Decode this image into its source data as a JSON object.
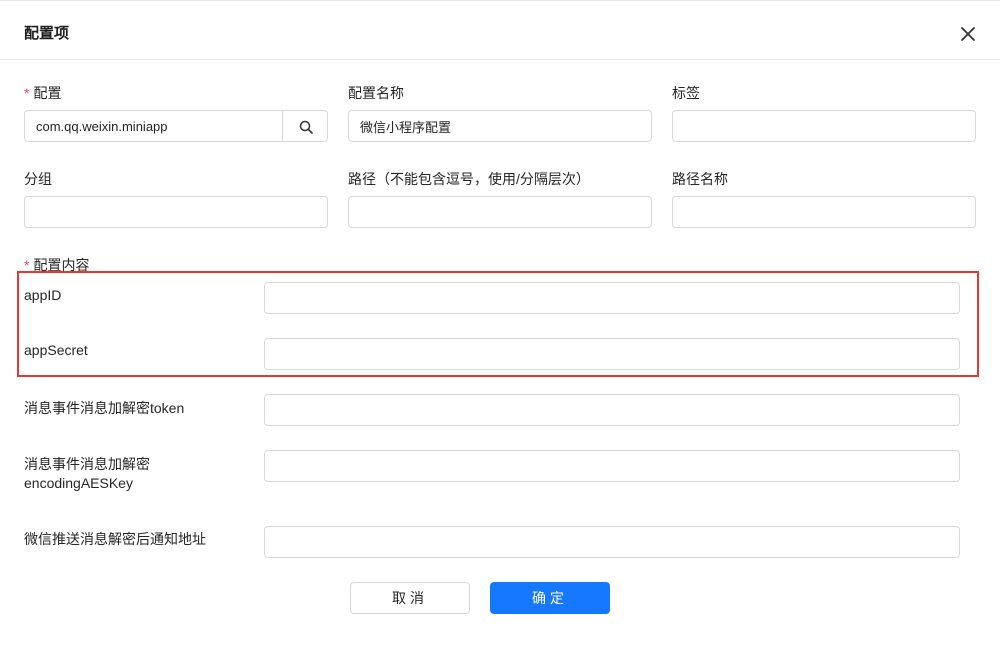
{
  "dialog": {
    "title": "配置项"
  },
  "form": {
    "config": {
      "label": "配置",
      "value": "com.qq.weixin.miniapp"
    },
    "config_name": {
      "label": "配置名称",
      "value": "微信小程序配置"
    },
    "tags": {
      "label": "标签",
      "value": ""
    },
    "group": {
      "label": "分组",
      "value": ""
    },
    "path": {
      "label": "路径（不能包含逗号，使用/分隔层次）",
      "value": ""
    },
    "path_name": {
      "label": "路径名称",
      "value": ""
    },
    "content_label": "配置内容",
    "required_mark": "*",
    "content_fields": {
      "app_id": {
        "label": "appID",
        "value": ""
      },
      "app_secret": {
        "label": "appSecret",
        "value": ""
      },
      "token": {
        "label": "消息事件消息加解密token",
        "value": ""
      },
      "aes_key": {
        "label_line1": "消息事件消息加解密",
        "label_line2": "encodingAESKey",
        "value": ""
      },
      "notify_url": {
        "label": "微信推送消息解密后通知地址",
        "value": ""
      }
    }
  },
  "buttons": {
    "cancel": "取消",
    "ok": "确定"
  },
  "colors": {
    "primary": "#1677ff",
    "required": "#e34d59",
    "highlight": "#e53935"
  }
}
